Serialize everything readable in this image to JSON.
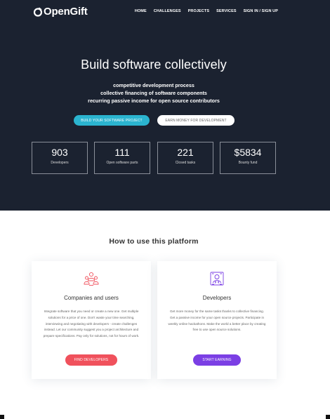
{
  "brand": {
    "name": "OpenGift"
  },
  "nav": {
    "items": [
      {
        "label": "HOME"
      },
      {
        "label": "CHALLENGES"
      },
      {
        "label": "PROJECTS"
      },
      {
        "label": "SERVICES"
      },
      {
        "label": "SIGN IN / SIGN UP"
      }
    ]
  },
  "hero": {
    "title": "Build software collectively",
    "lines": [
      "competitive development process",
      "collective financing of software components",
      "recurring passive income for open source contributors"
    ],
    "primary_button": "BUILD YOUR SOFTWARE PROJECT",
    "secondary_button": "EARN MONEY FOR DEVELOPMENT"
  },
  "stats": [
    {
      "value": "903",
      "label": "Developers"
    },
    {
      "value": "111",
      "label": "Open software parts"
    },
    {
      "value": "221",
      "label": "Closed tasks"
    },
    {
      "value": "$5834",
      "label": "Bounty fund"
    }
  ],
  "how": {
    "title": "How to use this platform",
    "cards": [
      {
        "icon": "group-users-icon",
        "title": "Companies and users",
        "text": "Integrate software that you need or create a new one. Get multiple solutions for a price of one. Don't waste your time searching, interviewing and negotiating with developers - create challenges instead. Let our community suggest you a project architecture and prepare specifications. Pay only for solutions, not for hours of work.",
        "button": "FIND DEVELOPERS",
        "button_color": "#f0515c"
      },
      {
        "icon": "developer-icon",
        "title": "Developers",
        "text": "Get more money for the same tasks thanks to collective financing. Get a passive income for your open source projects. Participate in weekly online hackathons. Make the world a better place by creating free to use open source solutions.",
        "button": "START EARNING",
        "button_color": "#7b3fe4"
      }
    ]
  },
  "colors": {
    "hero_bg": "#1b2230",
    "accent_cyan": "#2bb4cf",
    "accent_red": "#f0515c",
    "accent_purple": "#7b3fe4"
  }
}
